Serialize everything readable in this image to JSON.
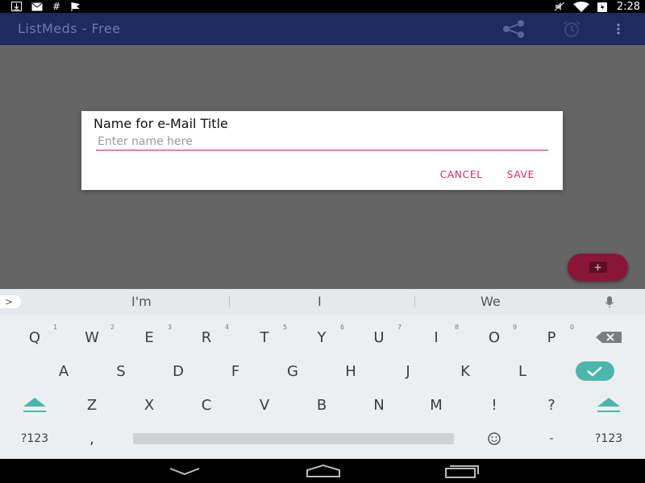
{
  "status_bar": {
    "left_icons": [
      "download-icon",
      "mail-icon",
      "hash-icon",
      "flag-icon"
    ],
    "right_icons": [
      "mute-icon",
      "wifi-icon",
      "battery-icon"
    ],
    "time": "2:28"
  },
  "app_bar": {
    "title": "ListMeds - Free",
    "actions": [
      "share-icon",
      "alarm-icon",
      "overflow-menu-icon"
    ]
  },
  "dialog": {
    "title": "Name for e-Mail Title",
    "input_value": "",
    "input_placeholder": "Enter name here",
    "cancel_label": "CANCEL",
    "save_label": "SAVE"
  },
  "colors": {
    "app_bar": "#1f2a5f",
    "accent": "#e91e63",
    "fab": "#8a1538",
    "keyboard_teal": "#4db6ac"
  },
  "keyboard": {
    "suggestions": [
      "I'm",
      "I",
      "We"
    ],
    "row1": [
      {
        "label": "Q",
        "hint": "1"
      },
      {
        "label": "W",
        "hint": "2"
      },
      {
        "label": "E",
        "hint": "3"
      },
      {
        "label": "R",
        "hint": "4"
      },
      {
        "label": "T",
        "hint": "5"
      },
      {
        "label": "Y",
        "hint": "6"
      },
      {
        "label": "U",
        "hint": "7"
      },
      {
        "label": "I",
        "hint": "8"
      },
      {
        "label": "O",
        "hint": "9"
      },
      {
        "label": "P",
        "hint": "0"
      }
    ],
    "row2": [
      "A",
      "S",
      "D",
      "F",
      "G",
      "H",
      "J",
      "K",
      "L"
    ],
    "row3": [
      "Z",
      "X",
      "C",
      "V",
      "B",
      "N",
      "M",
      "!",
      "?"
    ],
    "symbols_label": "?123",
    "comma_label": ",",
    "dash_label": "-",
    "symbols_label_right": "?123"
  }
}
